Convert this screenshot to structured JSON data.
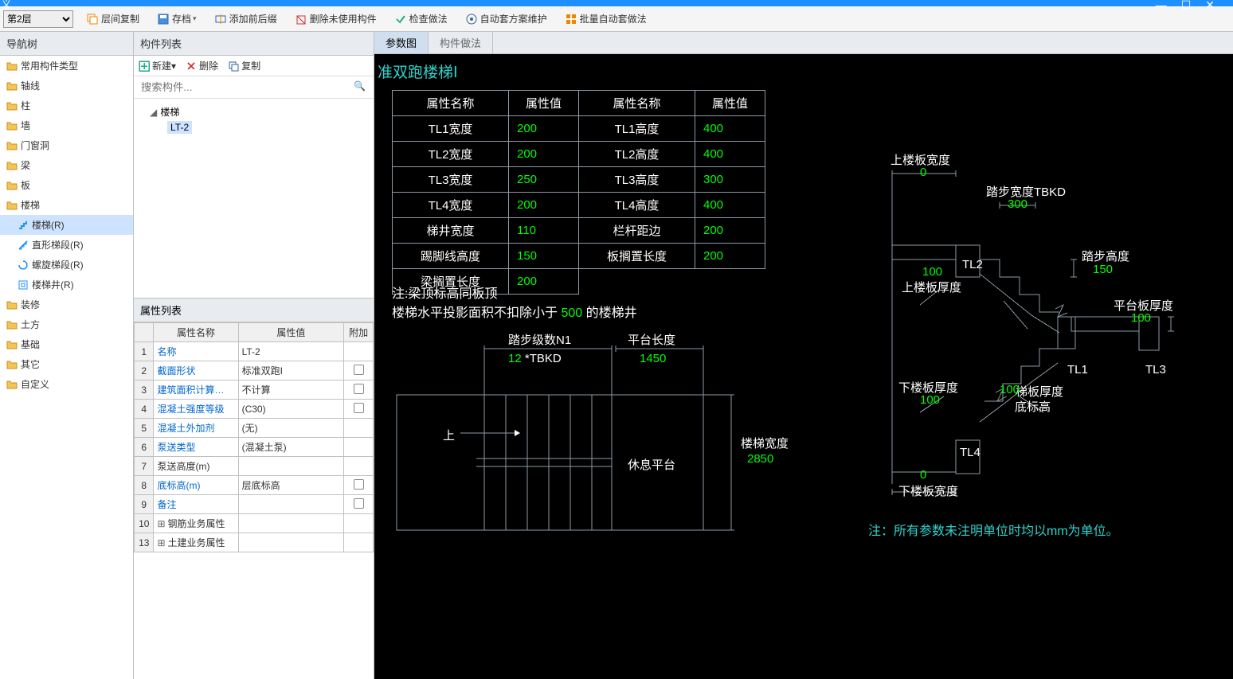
{
  "titlebar": {
    "label": "义",
    "min": "—",
    "max": "☐",
    "close": "✕"
  },
  "toolbar": {
    "floor_select": "第2层",
    "buttons": [
      {
        "icon": "copy",
        "label": "层间复制"
      },
      {
        "icon": "save",
        "label": "存档",
        "dd": true
      },
      {
        "icon": "addfix",
        "label": "添加前后缀"
      },
      {
        "icon": "del",
        "label": "删除未使用构件"
      },
      {
        "icon": "check",
        "label": "检查做法"
      },
      {
        "icon": "auto",
        "label": "自动套方案维护"
      },
      {
        "icon": "batch",
        "label": "批量自动套做法"
      }
    ]
  },
  "nav": {
    "header": "导航树",
    "items": [
      {
        "icon": "folder",
        "label": "常用构件类型"
      },
      {
        "icon": "folder",
        "label": "轴线"
      },
      {
        "icon": "folder",
        "label": "柱"
      },
      {
        "icon": "folder",
        "label": "墙"
      },
      {
        "icon": "folder",
        "label": "门窗洞"
      },
      {
        "icon": "folder",
        "label": "梁"
      },
      {
        "icon": "folder",
        "label": "板"
      },
      {
        "icon": "folder",
        "label": "楼梯",
        "children": [
          {
            "icon": "stair-blue",
            "label": "楼梯(R)",
            "selected": true
          },
          {
            "icon": "stair-straight",
            "label": "直形梯段(R)"
          },
          {
            "icon": "stair-spiral",
            "label": "螺旋梯段(R)"
          },
          {
            "icon": "stair-well",
            "label": "楼梯井(R)"
          }
        ]
      },
      {
        "icon": "folder",
        "label": "装修"
      },
      {
        "icon": "folder",
        "label": "土方"
      },
      {
        "icon": "folder",
        "label": "基础"
      },
      {
        "icon": "folder",
        "label": "其它"
      },
      {
        "icon": "folder",
        "label": "自定义"
      }
    ]
  },
  "complist": {
    "header": "构件列表",
    "buttons": {
      "new": "新建",
      "del": "删除",
      "copy": "复制"
    },
    "search_placeholder": "搜索构件...",
    "tree": {
      "root": "楼梯",
      "child": "LT-2"
    }
  },
  "proplist": {
    "header": "属性列表",
    "columns": {
      "name": "属性名称",
      "value": "属性值",
      "ext": "附加"
    },
    "rows": [
      {
        "n": "1",
        "name": "名称",
        "value": "LT-2",
        "blue": true
      },
      {
        "n": "2",
        "name": "截面形状",
        "value": "标准双跑I",
        "blue": true,
        "check": true
      },
      {
        "n": "3",
        "name": "建筑面积计算…",
        "value": "不计算",
        "blue": true,
        "check": true
      },
      {
        "n": "4",
        "name": "混凝土强度等级",
        "value": "(C30)",
        "blue": true,
        "check": true
      },
      {
        "n": "5",
        "name": "混凝土外加剂",
        "value": "(无)",
        "blue": true
      },
      {
        "n": "6",
        "name": "泵送类型",
        "value": "(混凝土泵)",
        "blue": true
      },
      {
        "n": "7",
        "name": "泵送高度(m)",
        "value": ""
      },
      {
        "n": "8",
        "name": "底标高(m)",
        "value": "层底标高",
        "blue": true,
        "check": true
      },
      {
        "n": "9",
        "name": "备注",
        "value": "",
        "blue": true,
        "check": true
      },
      {
        "n": "10",
        "name": "钢筋业务属性",
        "value": "",
        "expand": true
      },
      {
        "n": "13",
        "name": "土建业务属性",
        "value": "",
        "expand": true
      }
    ]
  },
  "tabs": {
    "t1": "参数图",
    "t2": "构件做法"
  },
  "canvas": {
    "title": "准双跑楼梯Ⅰ",
    "param_headers": [
      "属性名称",
      "属性值",
      "属性名称",
      "属性值"
    ],
    "param_rows": [
      [
        "TL1宽度",
        "200",
        "TL1高度",
        "400"
      ],
      [
        "TL2宽度",
        "200",
        "TL2高度",
        "400"
      ],
      [
        "TL3宽度",
        "250",
        "TL3高度",
        "300"
      ],
      [
        "TL4宽度",
        "200",
        "TL4高度",
        "400"
      ],
      [
        "梯井宽度",
        "110",
        "栏杆距边",
        "200"
      ],
      [
        "踢脚线高度",
        "150",
        "板搁置长度",
        "200"
      ],
      [
        "梁搁置长度",
        "200",
        "",
        ""
      ]
    ],
    "note_line1": "注:梁顶标高同板顶",
    "note_line2a": "楼梯水平投影面积不扣除小于 ",
    "note_line2b": "500",
    "note_line2c": " 的楼梯井",
    "plan": {
      "step_count_label": "踏步级数N1",
      "step_count_value": "12",
      "step_count_unit": " *TBKD",
      "platform_len_label": "平台长度",
      "platform_len_value": "1450",
      "up_label": "上",
      "rest_platform": "休息平台",
      "stair_width_label": "楼梯宽度",
      "stair_width_value": "2850"
    },
    "section": {
      "upper_board_width_label": "上楼板宽度",
      "upper_board_width_value": "0",
      "step_width_label": "踏步宽度TBKD",
      "step_width_value": "300",
      "step_height_label": "踏步高度",
      "step_height_value": "150",
      "tl2": "TL2",
      "upper_board_thick_label": "上楼板厚度",
      "upper_board_thick_value": "100",
      "platform_thick_label": "平台板厚度",
      "platform_thick_value": "100",
      "tl1": "TL1",
      "tl3": "TL3",
      "lower_board_thick_label": "下楼板厚度",
      "lower_board_thick_value": "100",
      "stair_board_thick_label": "梯板厚度",
      "stair_board_thick_value": "100",
      "bottom_elev": "底标高",
      "tl4": "TL4",
      "lower_board_width_label": "下楼板宽度",
      "lower_board_width_value": "0"
    },
    "foot_note": "注：所有参数未注明单位时均以mm为单位。"
  }
}
